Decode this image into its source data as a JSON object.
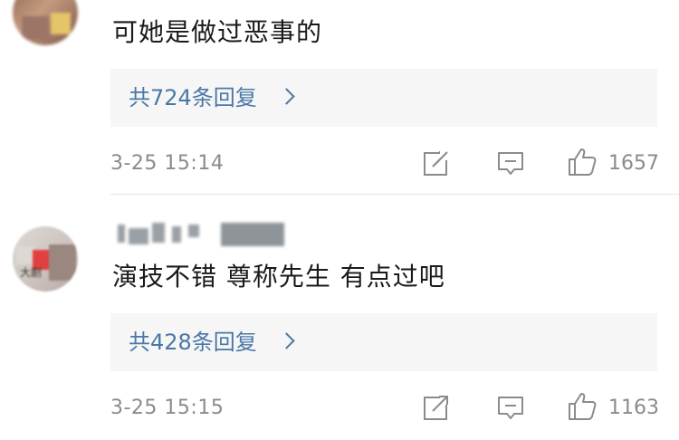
{
  "comments": [
    {
      "text": "可她是做过恶事的",
      "replies_label": "共724条回复",
      "timestamp": "3-25 15:14",
      "like_count": "1657"
    },
    {
      "text": "演技不错 尊称先生 有点过吧",
      "replies_label": "共428条回复",
      "timestamp": "3-25 15:15",
      "like_count": "1163",
      "avatar_text": "大剧"
    }
  ],
  "icons": {
    "share": "share-icon",
    "reply": "comment-icon",
    "like": "thumbs-up-icon"
  },
  "colors": {
    "link": "#4a78a6",
    "meta": "#8b8b8b",
    "text": "#1a1a1a",
    "reply_bg": "#f6f6f6"
  }
}
